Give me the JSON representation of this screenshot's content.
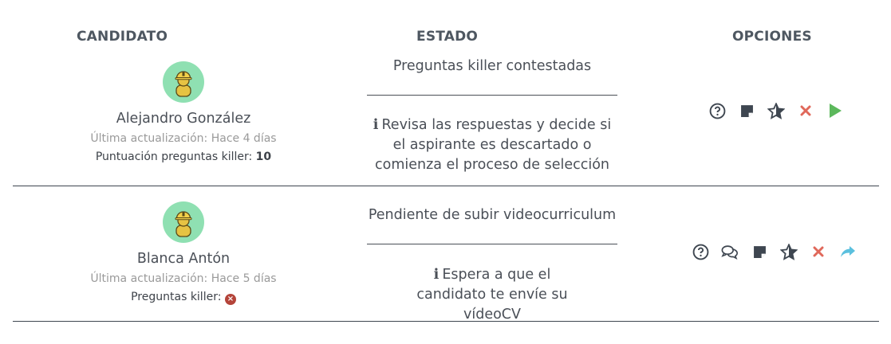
{
  "header": {
    "col_candidato": "CANDIDATO",
    "col_estado": "ESTADO",
    "col_opciones": "OPCIONES"
  },
  "colors": {
    "avatar_bg": "#8fe0b2",
    "discard": "#e0685a",
    "play": "#5cb85c",
    "forward": "#5bc0de",
    "error_badge": "#b4443a"
  },
  "candidates": [
    {
      "name": "Alejandro González",
      "updated": "Última actualización: Hace 4 días",
      "score_label": "Puntuación preguntas killer:",
      "score_value": "10",
      "estado_title": "Preguntas killer contestadas",
      "estado_message": "Revisa las respuestas y decide si el aspirante es descartado o comienza el proceso de selección",
      "options": [
        "help-icon",
        "note-icon",
        "star-icon",
        "discard-icon",
        "play-icon"
      ]
    },
    {
      "name": "Blanca Antón",
      "updated": "Última actualización: Hace 5 días",
      "score_label": "Preguntas killer:",
      "score_icon": "error-circle-icon",
      "estado_title": "Pendiente de subir videocurriculum",
      "estado_message": "Espera a que el candidato te envíe su vídeoCV",
      "options": [
        "help-icon",
        "chat-icon",
        "note-icon",
        "star-icon",
        "discard-icon",
        "forward-icon"
      ]
    }
  ]
}
